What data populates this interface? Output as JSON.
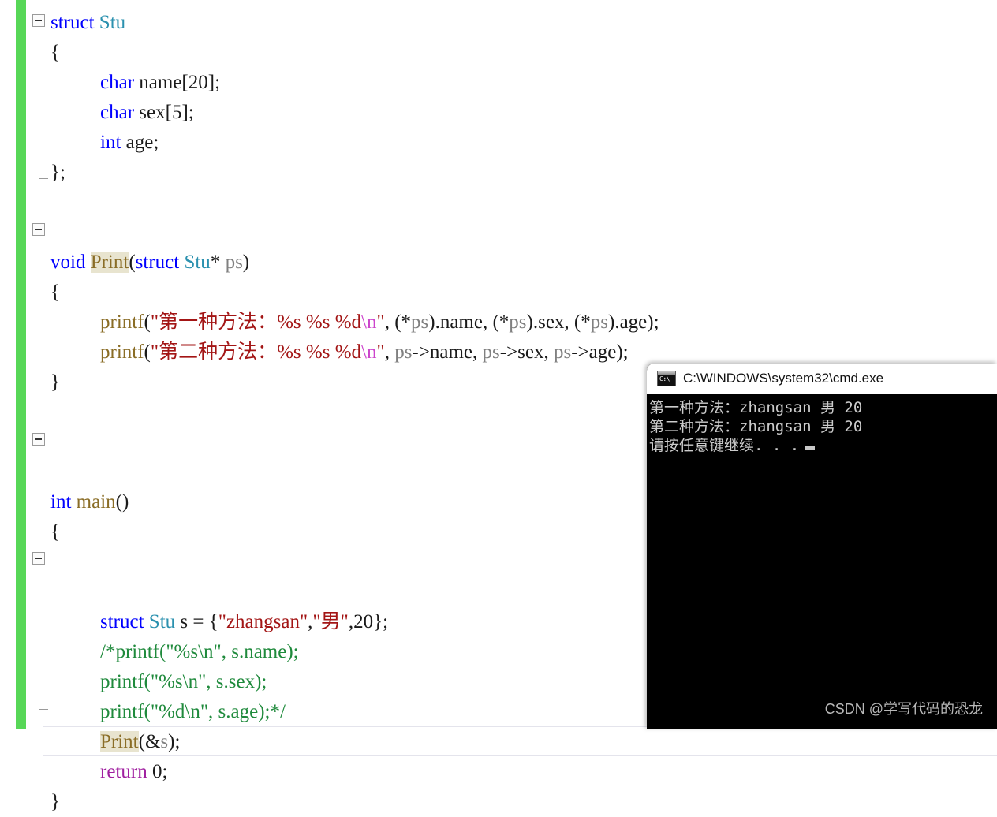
{
  "editor": {
    "name": "code-editor",
    "language": "c",
    "change_bar_color": "#57d757",
    "colors": {
      "keyword": "#0000ff",
      "type": "#2b91af",
      "function": "#8a6d26",
      "string": "#a31515",
      "escape": "#cc44cc",
      "control": "#a020a0",
      "variable": "#808080",
      "comment": "#1f8a3c",
      "highlight_bg": "#e8e4cf"
    },
    "lines": [
      {
        "n": 1,
        "indent": 0,
        "tokens": [
          {
            "t": "struct",
            "c": "kw"
          },
          {
            "t": " ",
            "c": "pun"
          },
          {
            "t": "Stu",
            "c": "type"
          }
        ]
      },
      {
        "n": 2,
        "indent": 0,
        "tokens": [
          {
            "t": "{",
            "c": "pun"
          }
        ]
      },
      {
        "n": 3,
        "indent": 1,
        "tokens": [
          {
            "t": "char",
            "c": "kw"
          },
          {
            "t": " name",
            "c": "pun"
          },
          {
            "t": "[",
            "c": "pun"
          },
          {
            "t": "20",
            "c": "num"
          },
          {
            "t": "];",
            "c": "pun"
          }
        ]
      },
      {
        "n": 4,
        "indent": 1,
        "tokens": [
          {
            "t": "char",
            "c": "kw"
          },
          {
            "t": " sex",
            "c": "pun"
          },
          {
            "t": "[",
            "c": "pun"
          },
          {
            "t": "5",
            "c": "num"
          },
          {
            "t": "];",
            "c": "pun"
          }
        ]
      },
      {
        "n": 5,
        "indent": 1,
        "tokens": [
          {
            "t": "int",
            "c": "kw"
          },
          {
            "t": " age;",
            "c": "pun"
          }
        ]
      },
      {
        "n": 6,
        "indent": 0,
        "tokens": [
          {
            "t": "};",
            "c": "pun"
          }
        ]
      },
      {
        "n": 7,
        "indent": 0,
        "tokens": []
      },
      {
        "n": 8,
        "indent": 0,
        "tokens": []
      },
      {
        "n": 9,
        "indent": 0,
        "tokens": [
          {
            "t": "void",
            "c": "kw"
          },
          {
            "t": " ",
            "c": "pun"
          },
          {
            "t": "Print",
            "c": "fnhl"
          },
          {
            "t": "(",
            "c": "pun"
          },
          {
            "t": "struct",
            "c": "kw"
          },
          {
            "t": " ",
            "c": "pun"
          },
          {
            "t": "Stu",
            "c": "type"
          },
          {
            "t": "*",
            "c": "pun"
          },
          {
            "t": " ",
            "c": "pun"
          },
          {
            "t": "ps",
            "c": "var"
          },
          {
            "t": ")",
            "c": "pun"
          }
        ]
      },
      {
        "n": 10,
        "indent": 0,
        "tokens": [
          {
            "t": "{",
            "c": "pun"
          }
        ]
      },
      {
        "n": 11,
        "indent": 1,
        "tokens": [
          {
            "t": "printf",
            "c": "fn"
          },
          {
            "t": "(",
            "c": "pun"
          },
          {
            "t": "\"第一种方法：%s %s %d",
            "c": "str"
          },
          {
            "t": "\\n",
            "c": "esc"
          },
          {
            "t": "\"",
            "c": "str"
          },
          {
            "t": ", (*",
            "c": "pun"
          },
          {
            "t": "ps",
            "c": "var"
          },
          {
            "t": ").name, (*",
            "c": "pun"
          },
          {
            "t": "ps",
            "c": "var"
          },
          {
            "t": ").sex, (*",
            "c": "pun"
          },
          {
            "t": "ps",
            "c": "var"
          },
          {
            "t": ").age);",
            "c": "pun"
          }
        ]
      },
      {
        "n": 12,
        "indent": 1,
        "tokens": [
          {
            "t": "printf",
            "c": "fn"
          },
          {
            "t": "(",
            "c": "pun"
          },
          {
            "t": "\"第二种方法：%s %s %d",
            "c": "str"
          },
          {
            "t": "\\n",
            "c": "esc"
          },
          {
            "t": "\"",
            "c": "str"
          },
          {
            "t": ", ",
            "c": "pun"
          },
          {
            "t": "ps",
            "c": "var"
          },
          {
            "t": "->name, ",
            "c": "pun"
          },
          {
            "t": "ps",
            "c": "var"
          },
          {
            "t": "->sex, ",
            "c": "pun"
          },
          {
            "t": "ps",
            "c": "var"
          },
          {
            "t": "->age);",
            "c": "pun"
          }
        ]
      },
      {
        "n": 13,
        "indent": 0,
        "tokens": [
          {
            "t": "}",
            "c": "pun"
          }
        ]
      },
      {
        "n": 14,
        "indent": 0,
        "tokens": []
      },
      {
        "n": 15,
        "indent": 0,
        "tokens": []
      },
      {
        "n": 16,
        "indent": 0,
        "tokens": []
      },
      {
        "n": 17,
        "indent": 0,
        "tokens": [
          {
            "t": "int",
            "c": "kw"
          },
          {
            "t": " ",
            "c": "pun"
          },
          {
            "t": "main",
            "c": "fn"
          },
          {
            "t": "()",
            "c": "pun"
          }
        ]
      },
      {
        "n": 18,
        "indent": 0,
        "tokens": [
          {
            "t": "{",
            "c": "pun"
          }
        ]
      },
      {
        "n": 19,
        "indent": 1,
        "tokens": []
      },
      {
        "n": 20,
        "indent": 1,
        "tokens": []
      },
      {
        "n": 21,
        "indent": 1,
        "tokens": [
          {
            "t": "struct",
            "c": "kw"
          },
          {
            "t": " ",
            "c": "pun"
          },
          {
            "t": "Stu",
            "c": "type"
          },
          {
            "t": " s = {",
            "c": "pun"
          },
          {
            "t": "\"zhangsan\"",
            "c": "str"
          },
          {
            "t": ",",
            "c": "pun"
          },
          {
            "t": "\"男\"",
            "c": "str"
          },
          {
            "t": ",",
            "c": "pun"
          },
          {
            "t": "20",
            "c": "num"
          },
          {
            "t": "};",
            "c": "pun"
          }
        ]
      },
      {
        "n": 22,
        "indent": 1,
        "tokens": [
          {
            "t": "/*printf(\"%s\\n\", s.name);",
            "c": "cmt"
          }
        ]
      },
      {
        "n": 23,
        "indent": 1,
        "tokens": [
          {
            "t": "printf(\"%s\\n\", s.sex);",
            "c": "cmt"
          }
        ]
      },
      {
        "n": 24,
        "indent": 1,
        "tokens": [
          {
            "t": "printf(\"%d\\n\", s.age);*/",
            "c": "cmt"
          }
        ]
      },
      {
        "n": 25,
        "indent": 1,
        "current": true,
        "tokens": [
          {
            "t": "Print",
            "c": "fnhl"
          },
          {
            "t": "(&",
            "c": "pun"
          },
          {
            "t": "s",
            "c": "var"
          },
          {
            "t": ");",
            "c": "pun"
          }
        ]
      },
      {
        "n": 26,
        "indent": 1,
        "tokens": [
          {
            "t": "return",
            "c": "ctl"
          },
          {
            "t": " ",
            "c": "pun"
          },
          {
            "t": "0",
            "c": "num"
          },
          {
            "t": ";",
            "c": "pun"
          }
        ]
      },
      {
        "n": 27,
        "indent": 0,
        "tokens": [
          {
            "t": "}",
            "c": "pun"
          }
        ]
      }
    ]
  },
  "console": {
    "title": "C:\\WINDOWS\\system32\\cmd.exe",
    "icon": "cmd-icon",
    "icon_prompt": "C:\\_",
    "background": "#000000",
    "text_color": "#cccccc",
    "lines": [
      "第一种方法：zhangsan 男 20",
      "第二种方法：zhangsan 男 20",
      "请按任意键继续. . ."
    ],
    "watermark": "CSDN @学写代码的恐龙"
  }
}
